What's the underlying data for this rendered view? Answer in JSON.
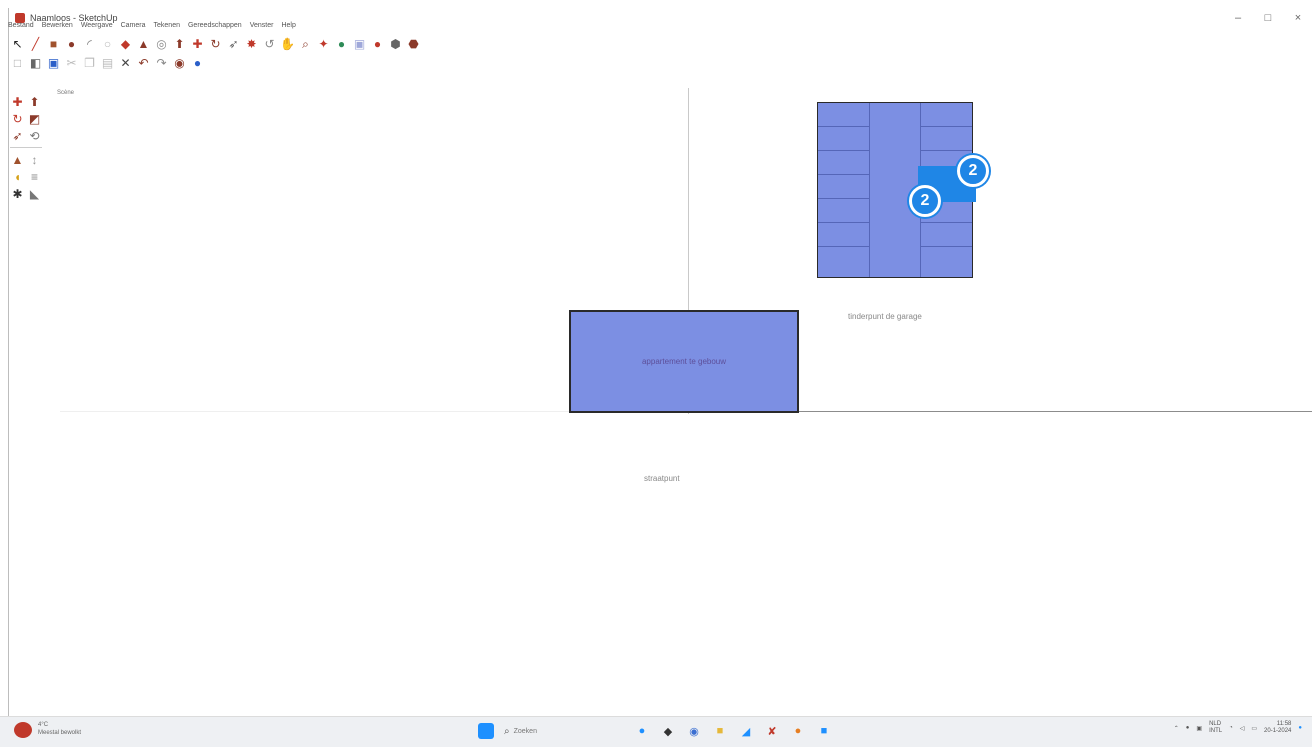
{
  "window": {
    "title": "Naamloos - SketchUp",
    "controls": [
      "–",
      "□",
      "×"
    ]
  },
  "menubar": {
    "items": [
      "Bestand",
      "Bewerken",
      "Weergave",
      "Camera",
      "Tekenen",
      "Gereedschappen",
      "Venster",
      "Help"
    ]
  },
  "canvas": {
    "scene_label": "Scène",
    "garage_label": "tinderpunt de garage",
    "house_label": "appartement te gebouw",
    "plot_label": "straatpunt",
    "badge_one": "2",
    "badge_two": "2"
  },
  "taskbar": {
    "weather_temp": "4°C",
    "weather_desc": "Meestal bewolkt",
    "search_placeholder": "Zoeken",
    "lang_top": "NLD",
    "lang_bottom": "INTL",
    "time": "11:58",
    "date": "20-1-2024"
  },
  "colors": {
    "accent": "#1f86e6",
    "model_fill": "#7c8fe3",
    "edge": "#2a2a2a"
  }
}
